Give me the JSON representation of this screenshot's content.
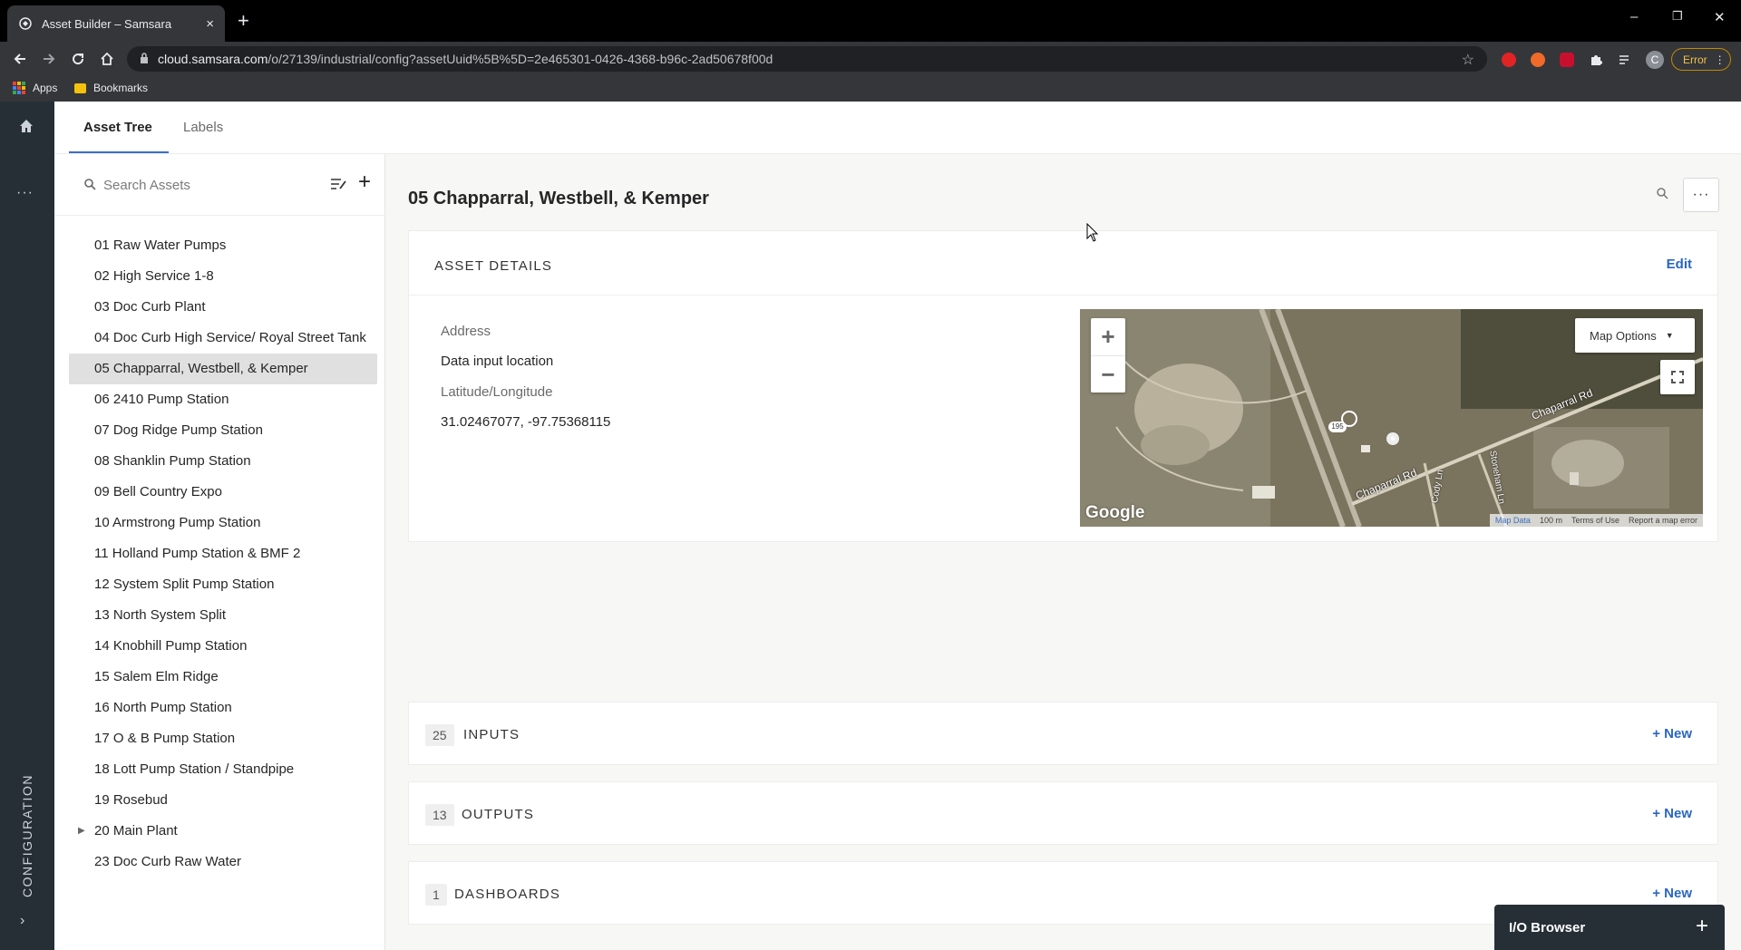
{
  "browser": {
    "tab_title": "Asset Builder – Samsara",
    "tab_close": "×",
    "new_tab": "+",
    "window_controls": {
      "minimize": "–",
      "restore": "❐",
      "close": "✕"
    },
    "url_host": "cloud.samsara.com",
    "url_path": "/o/27139/industrial/config?assetUuid%5B%5D=2e465301-0426-4368-b96c-2ad50678f00d",
    "profile_initial": "C",
    "error_label": "Error",
    "bookmarks": {
      "apps": "Apps",
      "bookmarks": "Bookmarks"
    }
  },
  "rail": {
    "more": "···",
    "config_label": "CONFIGURATION",
    "expand": "›"
  },
  "tabs": {
    "asset_tree": "Asset Tree",
    "labels": "Labels"
  },
  "sidebar": {
    "search_placeholder": "Search Assets",
    "add": "+",
    "assets": [
      "01 Raw Water Pumps",
      "02 High Service 1-8",
      "03 Doc Curb Plant",
      "04 Doc Curb High Service/ Royal Street Tank",
      "05 Chapparral, Westbell, & Kemper",
      "06 2410 Pump Station",
      "07 Dog Ridge Pump Station",
      "08 Shanklin Pump Station",
      "09 Bell Country Expo",
      "10 Armstrong Pump Station",
      "11 Holland Pump Station & BMF 2",
      "12 System Split Pump Station",
      "13 North System Split",
      "14 Knobhill Pump Station",
      "15 Salem Elm Ridge",
      "16 North Pump Station",
      "17 O & B Pump Station",
      "18 Lott Pump Station / Standpipe",
      "19 Rosebud",
      "20 Main Plant",
      "23 Doc Curb Raw Water"
    ],
    "expand_caret": "▶"
  },
  "main": {
    "title": "05 Chapparral, Westbell, & Kemper",
    "more": "···",
    "details": {
      "title": "ASSET DETAILS",
      "edit": "Edit",
      "address_label": "Address",
      "address_value": "Data input location",
      "latlng_label": "Latitude/Longitude",
      "latlng_value": "31.02467077, -97.75368115"
    },
    "map": {
      "zoom_in": "+",
      "zoom_out": "−",
      "options": "Map Options",
      "options_caret": "▼",
      "brand": "Google",
      "map_data": "Map Data",
      "scale": "100 m",
      "terms": "Terms of Use",
      "report": "Report a map error",
      "road_1": "Chaparral Rd",
      "road_2": "Chaparral Rd",
      "road_3": "Cody Ln",
      "road_4": "Stoneham Ln",
      "highway": "195"
    },
    "sections": {
      "inputs": {
        "count": "25",
        "label": "INPUTS",
        "new": "+ New"
      },
      "outputs": {
        "count": "13",
        "label": "OUTPUTS",
        "new": "+ New"
      },
      "dashboards": {
        "count": "1",
        "label": "DASHBOARDS",
        "new": "+ New"
      }
    }
  },
  "io_browser": {
    "label": "I/O Browser",
    "plus": "+"
  },
  "colors": {
    "accent": "#2a67c0",
    "rail": "#262f36",
    "selected_row": "#e0e0e0"
  }
}
